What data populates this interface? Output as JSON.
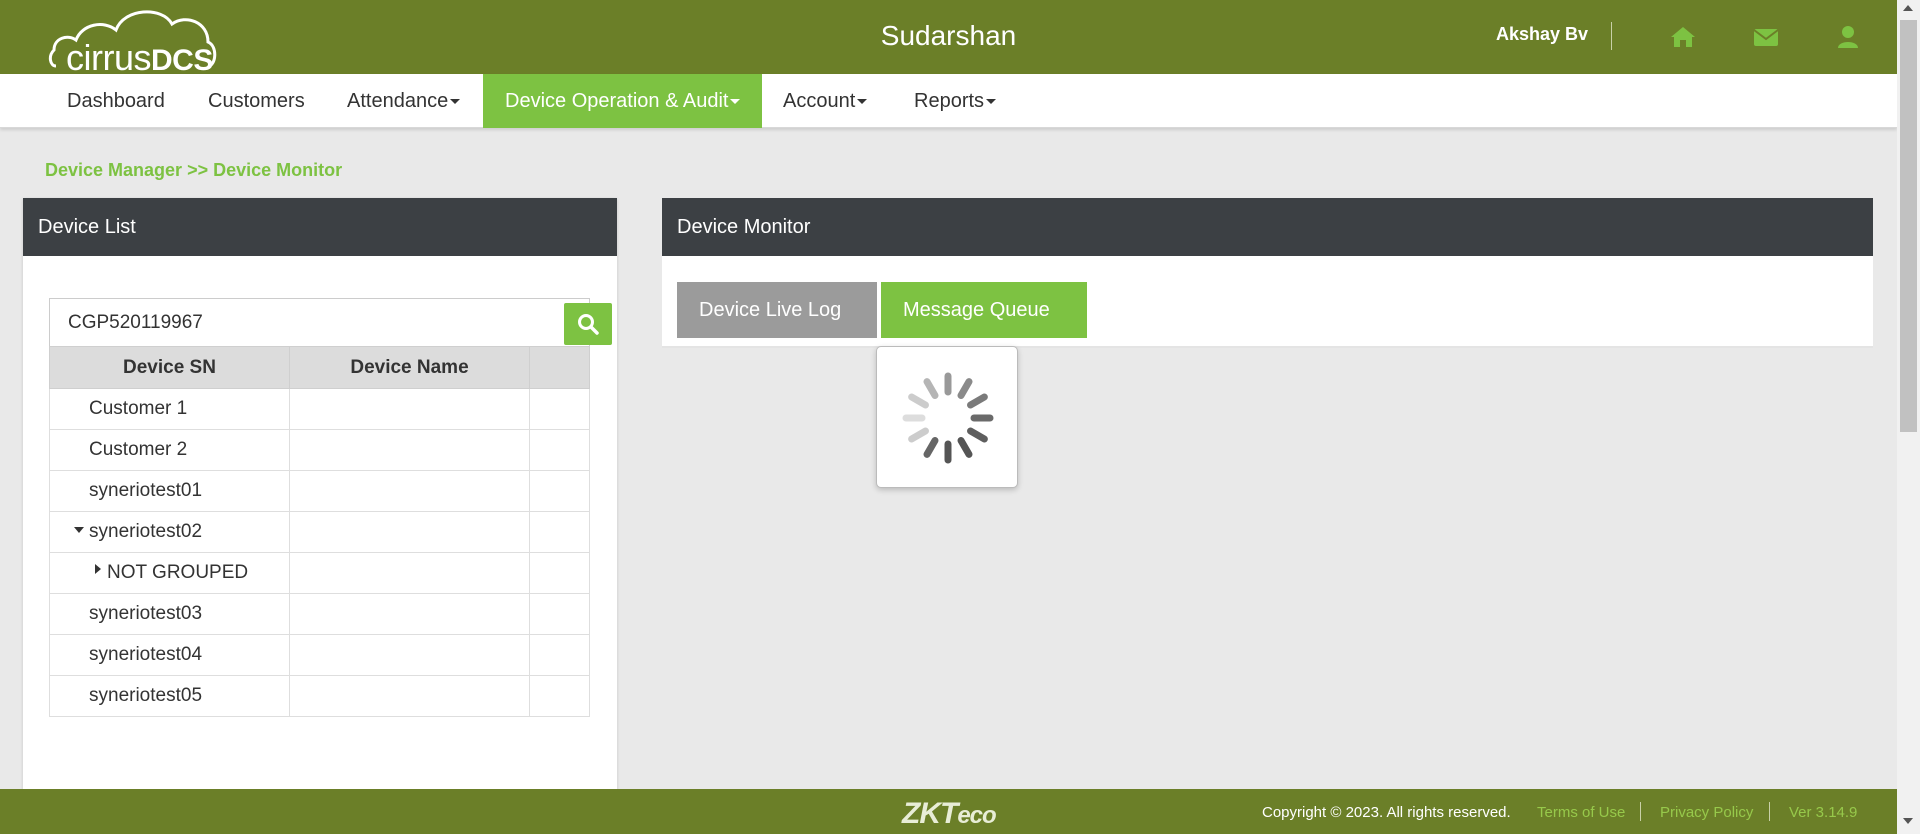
{
  "header": {
    "logo_text_light": "cirrus",
    "logo_text_bold": "DCS",
    "title": "Sudarshan",
    "user_name": "Akshay Bv",
    "icons": [
      "home-icon",
      "envelope-icon",
      "user-icon"
    ]
  },
  "nav": {
    "items": [
      {
        "label": "Dashboard"
      },
      {
        "label": "Customers"
      },
      {
        "label": "Attendance"
      },
      {
        "label": "Device Operation & Audit"
      },
      {
        "label": "Account"
      },
      {
        "label": "Reports"
      }
    ],
    "active_index": 3
  },
  "breadcrumb": "Device Manager >> Device Monitor",
  "device_list": {
    "title": "Device List",
    "search_value": "CGP520119967",
    "columns": [
      "Device SN",
      "Device Name",
      ""
    ],
    "rows": [
      {
        "sn": "Customer 1",
        "name": ""
      },
      {
        "sn": "Customer 2",
        "name": ""
      },
      {
        "sn": "syneriotest01",
        "name": ""
      },
      {
        "sn": "syneriotest02",
        "name": "",
        "expanded": true
      },
      {
        "sn": "NOT GROUPED",
        "name": "",
        "child": true
      },
      {
        "sn": "syneriotest03",
        "name": ""
      },
      {
        "sn": "syneriotest04",
        "name": ""
      },
      {
        "sn": "syneriotest05",
        "name": ""
      }
    ]
  },
  "device_monitor": {
    "title": "Device Monitor",
    "tabs": [
      {
        "label": "Device Live Log"
      },
      {
        "label": "Message Queue"
      }
    ],
    "active_tab": 1,
    "loading": true
  },
  "footer": {
    "brand": "ZKTeco",
    "brand_main": "ZKT",
    "brand_tail": "eco",
    "copyright": "Copyright © 2023. All rights reserved.",
    "links": [
      "Terms of Use",
      "Privacy Policy"
    ],
    "version": "Ver 3.14.9"
  },
  "colors": {
    "header_bg": "#6b7f28",
    "accent_green": "#7dc242",
    "panel_head_bg": "#3c4044",
    "page_bg": "#e9e9e9"
  }
}
